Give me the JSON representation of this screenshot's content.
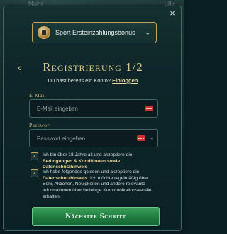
{
  "background": {
    "left_text": "Maine",
    "right_text": "Lille"
  },
  "modal": {
    "close_label": "×",
    "bonus_selector": {
      "label": "Sport Ersteinzahlungsbonus",
      "icon": "bonus-coin-icon"
    },
    "title": "Registrierung 1/2",
    "login_prompt": "Du hast bereits ein Konto?",
    "login_link": "Einloggen",
    "email": {
      "label": "E-Mail",
      "placeholder": "E-Mail eingeben",
      "value": ""
    },
    "password": {
      "label": "Passwort",
      "placeholder": "Passwort eingeben",
      "value": ""
    },
    "consent1": {
      "checked": true,
      "text_a": "Ich bin über 18 Jahre alt und akzeptiere die",
      "link": "Bedingungen & Konditionen sowie Datenschutzhinweis"
    },
    "consent2": {
      "checked": true,
      "text_a": "Ich habe folgendes gelesen und akzeptiere die",
      "link": "Datenschutzhinweis.",
      "text_b": "Ich möchte regelmäßig über Boni, Aktionen, Neuigkeiten und andere relevante Informationen über beliebige Kommunikationskanäle erhalten."
    },
    "submit_label": "Nächster Schritt"
  },
  "colors": {
    "accent_gold": "#c6a25a",
    "cta_green": "#1f7a3e",
    "password_manager_red": "#c9322f"
  }
}
